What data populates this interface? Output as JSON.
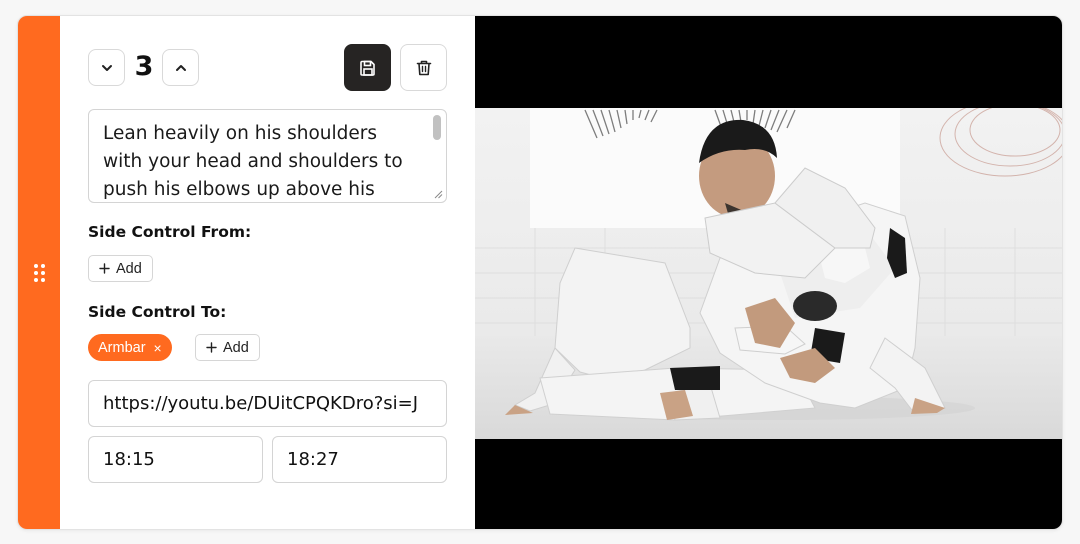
{
  "controls": {
    "step_number": "3",
    "decrement_icon": "chevron-down-icon",
    "increment_icon": "chevron-up-icon",
    "save_icon": "save-icon",
    "delete_icon": "trash-icon"
  },
  "description": {
    "text": "Lean heavily on his shoulders with your head and shoulders to push his elbows up above his head"
  },
  "side_control_from": {
    "label": "Side Control From:",
    "add_label": "Add",
    "tags": []
  },
  "side_control_to": {
    "label": "Side Control To:",
    "add_label": "Add",
    "tags": [
      {
        "label": "Armbar",
        "remove": "×"
      }
    ]
  },
  "video": {
    "url": "https://youtu.be/DUitCPQKDro?si=J",
    "start_time": "18:15",
    "end_time": "18:27"
  },
  "colors": {
    "accent": "#ff6a1f",
    "save_button": "#262423"
  }
}
